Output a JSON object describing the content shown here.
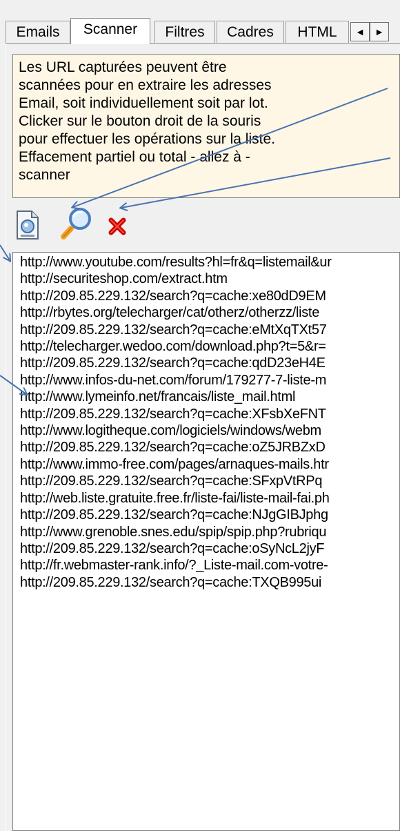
{
  "tabs": [
    {
      "label": "Emails",
      "active": false
    },
    {
      "label": "Scanner",
      "active": true
    },
    {
      "label": "Filtres",
      "active": false
    },
    {
      "label": "Cadres",
      "active": false
    },
    {
      "label": "HTML",
      "active": false
    }
  ],
  "tab_scroll": {
    "left": "◄",
    "right": "►"
  },
  "description": "Les URL capturées peuvent être\nscannées pour en extraire les adresses\nEmail, soit individuellement soit par lot.\nClicker sur le bouton droit de la souris\npour effectuer les opérations sur la liste.\nEffacement partiel ou total - allez à -\nscanner",
  "toolbar": {
    "buttons": [
      {
        "icon": "page-icon"
      },
      {
        "icon": "magnifier-icon"
      },
      {
        "icon": "delete-x-icon"
      }
    ]
  },
  "urls": [
    "http://www.youtube.com/results?hl=fr&q=listemail&ur",
    "http://securiteshop.com/extract.htm",
    "http://209.85.229.132/search?q=cache:xe80dD9EM",
    "http://rbytes.org/telecharger/cat/otherz/otherzz/liste",
    "http://209.85.229.132/search?q=cache:eMtXqTXt57",
    "http://telecharger.wedoo.com/download.php?t=5&r=",
    "http://209.85.229.132/search?q=cache:qdD23eH4E",
    "http://www.infos-du-net.com/forum/179277-7-liste-m",
    "http://www.lymeinfo.net/francais/liste_mail.html",
    "http://209.85.229.132/search?q=cache:XFsbXeFNT",
    "http://www.logitheque.com/logiciels/windows/webm",
    "http://209.85.229.132/search?q=cache:oZ5JRBZxD",
    "http://www.immo-free.com/pages/arnaques-mails.htr",
    "http://209.85.229.132/search?q=cache:SFxpVtRPq",
    "http://web.liste.gratuite.free.fr/liste-fai/liste-mail-fai.ph",
    "http://209.85.229.132/search?q=cache:NJgGIBJphg",
    "http://www.grenoble.snes.edu/spip/spip.php?rubriqu",
    "http://209.85.229.132/search?q=cache:oSyNcL2jyF",
    "http://fr.webmaster-rank.info/?_Liste-mail.com-votre-",
    "http://209.85.229.132/search?q=cache:TXQB995ui"
  ],
  "colors": {
    "description_bg": "#fff7e6",
    "arrow": "#4a72b0",
    "delete": "#cc0000"
  }
}
